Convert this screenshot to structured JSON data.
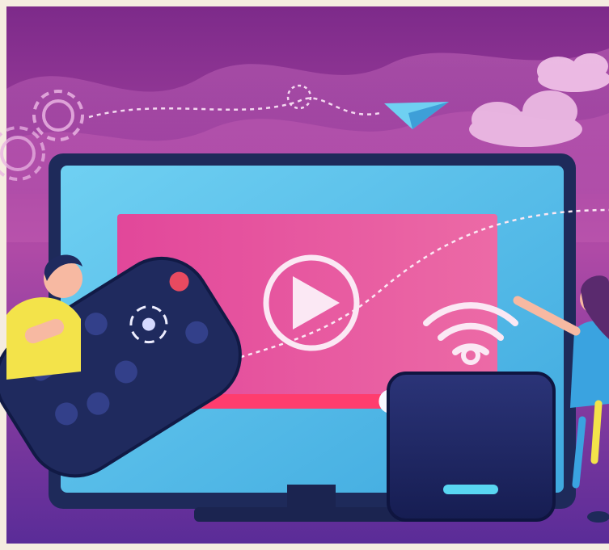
{
  "illustration": {
    "subject": "streaming-tv-with-remote-and-set-top-box",
    "icons": [
      "gear-icon",
      "paper-plane-icon",
      "play-icon",
      "wifi-icon",
      "cloud-icon"
    ],
    "playback_progress": 0.72,
    "colors": {
      "frame": "#f5ece0",
      "bg_top": "#8a2a8c",
      "bg_mid": "#b24aa8",
      "bg_bottom": "#5a2a9a",
      "tv_bezel": "#1e2a5a",
      "screen_outer": "#5fc6ee",
      "screen_inner": "#e0509a",
      "remote": "#1f2a5e",
      "box": "#1c2563",
      "accent_cyan": "#59d6f2",
      "progress_red": "#ff3d6e",
      "person_shirt": "#f3e34a",
      "woman_shirt": "#3aa3e0"
    }
  }
}
